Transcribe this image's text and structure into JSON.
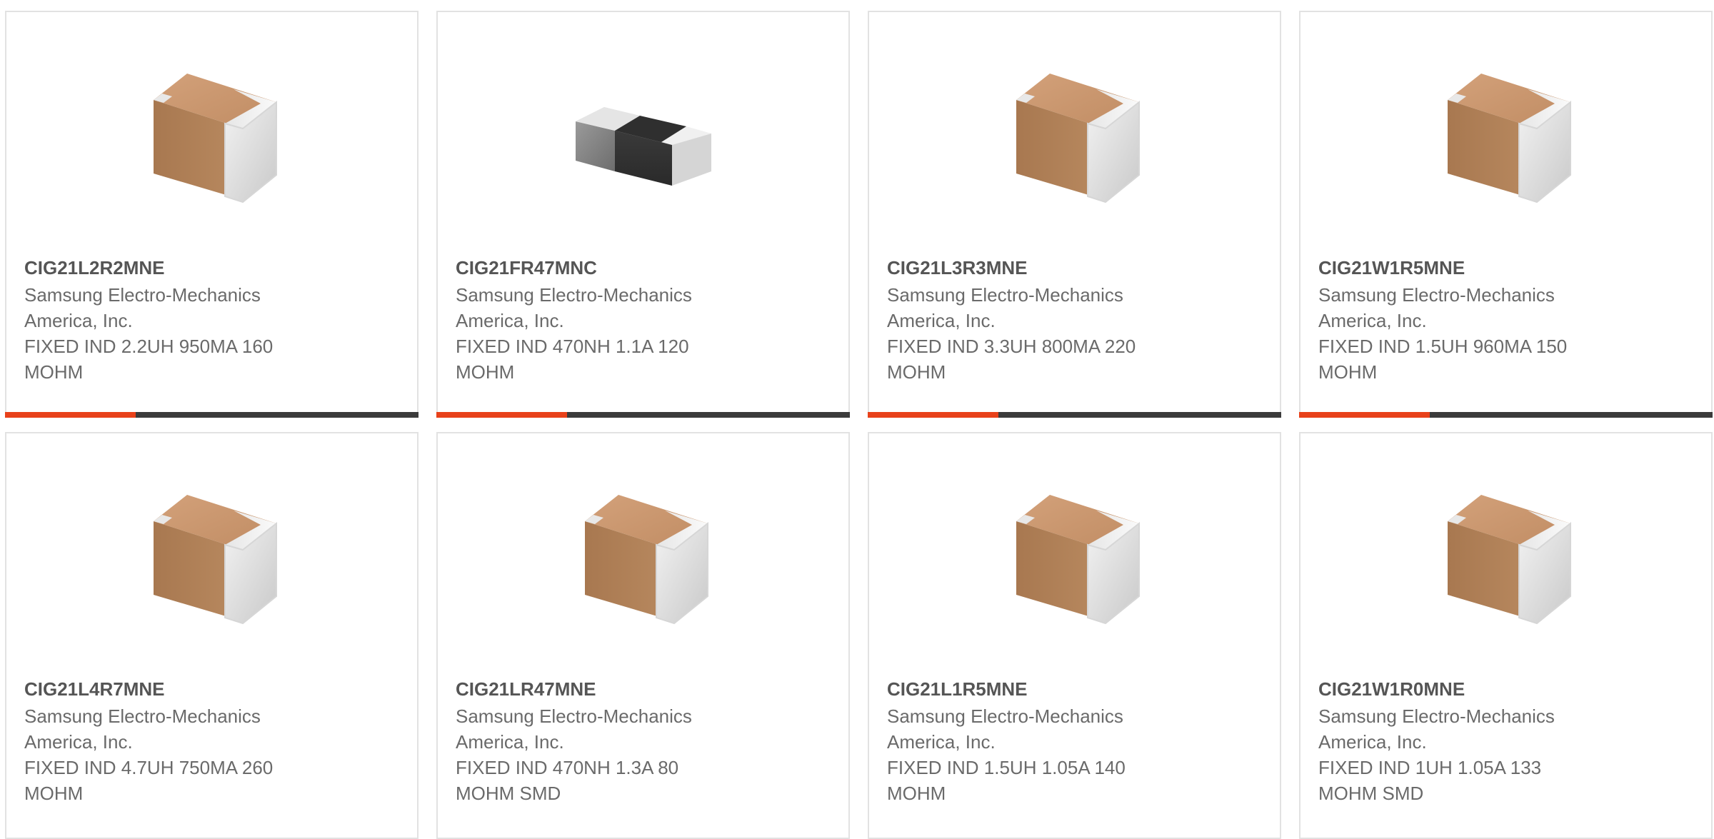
{
  "colors": {
    "accent": "#e8411a",
    "bar": "#3b3b3b",
    "border": "#e2e2e2",
    "text": "#6a6a6a"
  },
  "products": [
    {
      "part_number": "CIG21L2R2MNE",
      "manufacturer": "Samsung Electro-Mechanics America, Inc.",
      "description": "FIXED IND 2.2UH 950MA 160 MOHM",
      "image": "brown-chip-component-icon"
    },
    {
      "part_number": "CIG21FR47MNC",
      "manufacturer": "Samsung Electro-Mechanics America, Inc.",
      "description": "FIXED IND 470NH 1.1A 120 MOHM",
      "image": "black-chip-component-icon"
    },
    {
      "part_number": "CIG21L3R3MNE",
      "manufacturer": "Samsung Electro-Mechanics America, Inc.",
      "description": "FIXED IND 3.3UH 800MA 220 MOHM",
      "image": "brown-chip-component-icon"
    },
    {
      "part_number": "CIG21W1R5MNE",
      "manufacturer": "Samsung Electro-Mechanics America, Inc.",
      "description": "FIXED IND 1.5UH 960MA 150 MOHM",
      "image": "brown-chip-component-icon"
    },
    {
      "part_number": "CIG21L4R7MNE",
      "manufacturer": "Samsung Electro-Mechanics America, Inc.",
      "description": "FIXED IND 4.7UH 750MA 260 MOHM",
      "image": "brown-chip-component-icon"
    },
    {
      "part_number": "CIG21LR47MNE",
      "manufacturer": "Samsung Electro-Mechanics America, Inc.",
      "description": "FIXED IND 470NH 1.3A 80 MOHM SMD",
      "image": "brown-chip-component-icon"
    },
    {
      "part_number": "CIG21L1R5MNE",
      "manufacturer": "Samsung Electro-Mechanics America, Inc.",
      "description": "FIXED IND 1.5UH 1.05A 140 MOHM",
      "image": "brown-chip-component-icon"
    },
    {
      "part_number": "CIG21W1R0MNE",
      "manufacturer": "Samsung Electro-Mechanics America, Inc.",
      "description": "FIXED IND 1UH 1.05A 133 MOHM SMD",
      "image": "brown-chip-component-icon"
    }
  ]
}
